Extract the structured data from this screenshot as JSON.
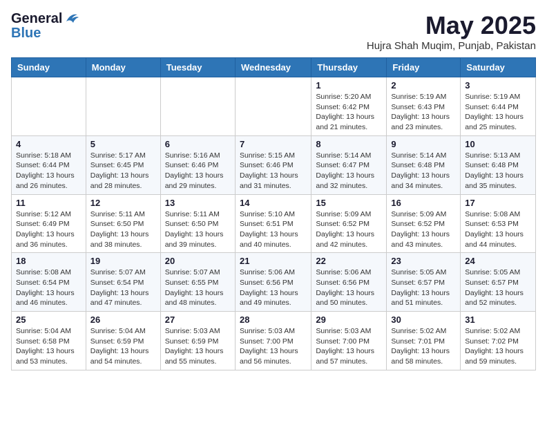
{
  "header": {
    "logo_general": "General",
    "logo_blue": "Blue",
    "month_year": "May 2025",
    "location": "Hujra Shah Muqim, Punjab, Pakistan"
  },
  "weekdays": [
    "Sunday",
    "Monday",
    "Tuesday",
    "Wednesday",
    "Thursday",
    "Friday",
    "Saturday"
  ],
  "weeks": [
    [
      {
        "date": "",
        "info": ""
      },
      {
        "date": "",
        "info": ""
      },
      {
        "date": "",
        "info": ""
      },
      {
        "date": "",
        "info": ""
      },
      {
        "date": "1",
        "info": "Sunrise: 5:20 AM\nSunset: 6:42 PM\nDaylight: 13 hours\nand 21 minutes."
      },
      {
        "date": "2",
        "info": "Sunrise: 5:19 AM\nSunset: 6:43 PM\nDaylight: 13 hours\nand 23 minutes."
      },
      {
        "date": "3",
        "info": "Sunrise: 5:19 AM\nSunset: 6:44 PM\nDaylight: 13 hours\nand 25 minutes."
      }
    ],
    [
      {
        "date": "4",
        "info": "Sunrise: 5:18 AM\nSunset: 6:44 PM\nDaylight: 13 hours\nand 26 minutes."
      },
      {
        "date": "5",
        "info": "Sunrise: 5:17 AM\nSunset: 6:45 PM\nDaylight: 13 hours\nand 28 minutes."
      },
      {
        "date": "6",
        "info": "Sunrise: 5:16 AM\nSunset: 6:46 PM\nDaylight: 13 hours\nand 29 minutes."
      },
      {
        "date": "7",
        "info": "Sunrise: 5:15 AM\nSunset: 6:46 PM\nDaylight: 13 hours\nand 31 minutes."
      },
      {
        "date": "8",
        "info": "Sunrise: 5:14 AM\nSunset: 6:47 PM\nDaylight: 13 hours\nand 32 minutes."
      },
      {
        "date": "9",
        "info": "Sunrise: 5:14 AM\nSunset: 6:48 PM\nDaylight: 13 hours\nand 34 minutes."
      },
      {
        "date": "10",
        "info": "Sunrise: 5:13 AM\nSunset: 6:48 PM\nDaylight: 13 hours\nand 35 minutes."
      }
    ],
    [
      {
        "date": "11",
        "info": "Sunrise: 5:12 AM\nSunset: 6:49 PM\nDaylight: 13 hours\nand 36 minutes."
      },
      {
        "date": "12",
        "info": "Sunrise: 5:11 AM\nSunset: 6:50 PM\nDaylight: 13 hours\nand 38 minutes."
      },
      {
        "date": "13",
        "info": "Sunrise: 5:11 AM\nSunset: 6:50 PM\nDaylight: 13 hours\nand 39 minutes."
      },
      {
        "date": "14",
        "info": "Sunrise: 5:10 AM\nSunset: 6:51 PM\nDaylight: 13 hours\nand 40 minutes."
      },
      {
        "date": "15",
        "info": "Sunrise: 5:09 AM\nSunset: 6:52 PM\nDaylight: 13 hours\nand 42 minutes."
      },
      {
        "date": "16",
        "info": "Sunrise: 5:09 AM\nSunset: 6:52 PM\nDaylight: 13 hours\nand 43 minutes."
      },
      {
        "date": "17",
        "info": "Sunrise: 5:08 AM\nSunset: 6:53 PM\nDaylight: 13 hours\nand 44 minutes."
      }
    ],
    [
      {
        "date": "18",
        "info": "Sunrise: 5:08 AM\nSunset: 6:54 PM\nDaylight: 13 hours\nand 46 minutes."
      },
      {
        "date": "19",
        "info": "Sunrise: 5:07 AM\nSunset: 6:54 PM\nDaylight: 13 hours\nand 47 minutes."
      },
      {
        "date": "20",
        "info": "Sunrise: 5:07 AM\nSunset: 6:55 PM\nDaylight: 13 hours\nand 48 minutes."
      },
      {
        "date": "21",
        "info": "Sunrise: 5:06 AM\nSunset: 6:56 PM\nDaylight: 13 hours\nand 49 minutes."
      },
      {
        "date": "22",
        "info": "Sunrise: 5:06 AM\nSunset: 6:56 PM\nDaylight: 13 hours\nand 50 minutes."
      },
      {
        "date": "23",
        "info": "Sunrise: 5:05 AM\nSunset: 6:57 PM\nDaylight: 13 hours\nand 51 minutes."
      },
      {
        "date": "24",
        "info": "Sunrise: 5:05 AM\nSunset: 6:57 PM\nDaylight: 13 hours\nand 52 minutes."
      }
    ],
    [
      {
        "date": "25",
        "info": "Sunrise: 5:04 AM\nSunset: 6:58 PM\nDaylight: 13 hours\nand 53 minutes."
      },
      {
        "date": "26",
        "info": "Sunrise: 5:04 AM\nSunset: 6:59 PM\nDaylight: 13 hours\nand 54 minutes."
      },
      {
        "date": "27",
        "info": "Sunrise: 5:03 AM\nSunset: 6:59 PM\nDaylight: 13 hours\nand 55 minutes."
      },
      {
        "date": "28",
        "info": "Sunrise: 5:03 AM\nSunset: 7:00 PM\nDaylight: 13 hours\nand 56 minutes."
      },
      {
        "date": "29",
        "info": "Sunrise: 5:03 AM\nSunset: 7:00 PM\nDaylight: 13 hours\nand 57 minutes."
      },
      {
        "date": "30",
        "info": "Sunrise: 5:02 AM\nSunset: 7:01 PM\nDaylight: 13 hours\nand 58 minutes."
      },
      {
        "date": "31",
        "info": "Sunrise: 5:02 AM\nSunset: 7:02 PM\nDaylight: 13 hours\nand 59 minutes."
      }
    ]
  ]
}
